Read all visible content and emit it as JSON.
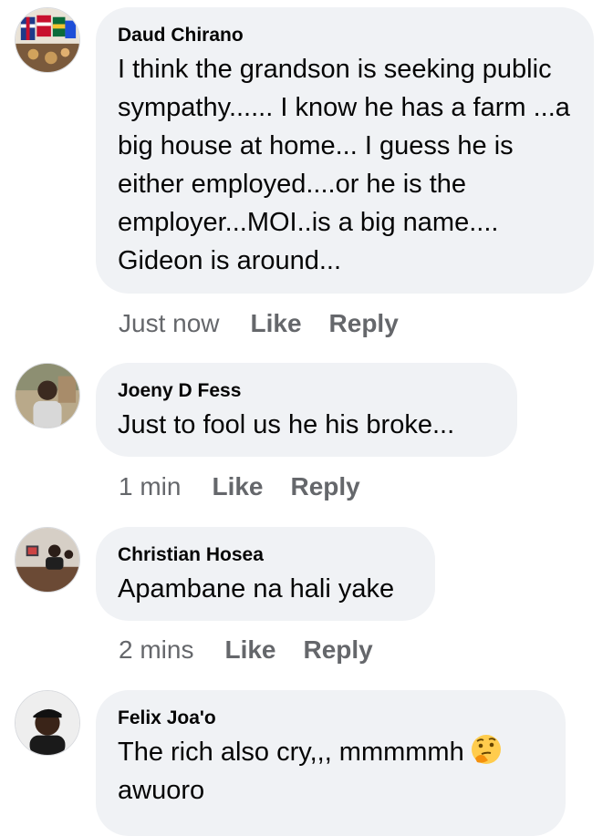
{
  "comments": [
    {
      "author": "Daud Chirano",
      "text": "I think the grandson is seeking public sympathy...... I know he has a farm ...a big house at home... I guess he is either employed....or he is the employer...MOI..is a big name.... Gideon is around...",
      "time": "Just now",
      "like": "Like",
      "reply": "Reply"
    },
    {
      "author": "Joeny D Fess",
      "text": "Just to fool  us he his broke...",
      "time": "1 min",
      "like": "Like",
      "reply": "Reply"
    },
    {
      "author": "Christian Hosea",
      "text": "Apambane na hali yake",
      "time": "2 mins",
      "like": "Like",
      "reply": "Reply"
    },
    {
      "author": "Felix Joa'o",
      "text": "The rich also cry,,, mmmmmh",
      "text_after_emoji": "awuoro",
      "emoji": "thinking-face-icon"
    }
  ]
}
